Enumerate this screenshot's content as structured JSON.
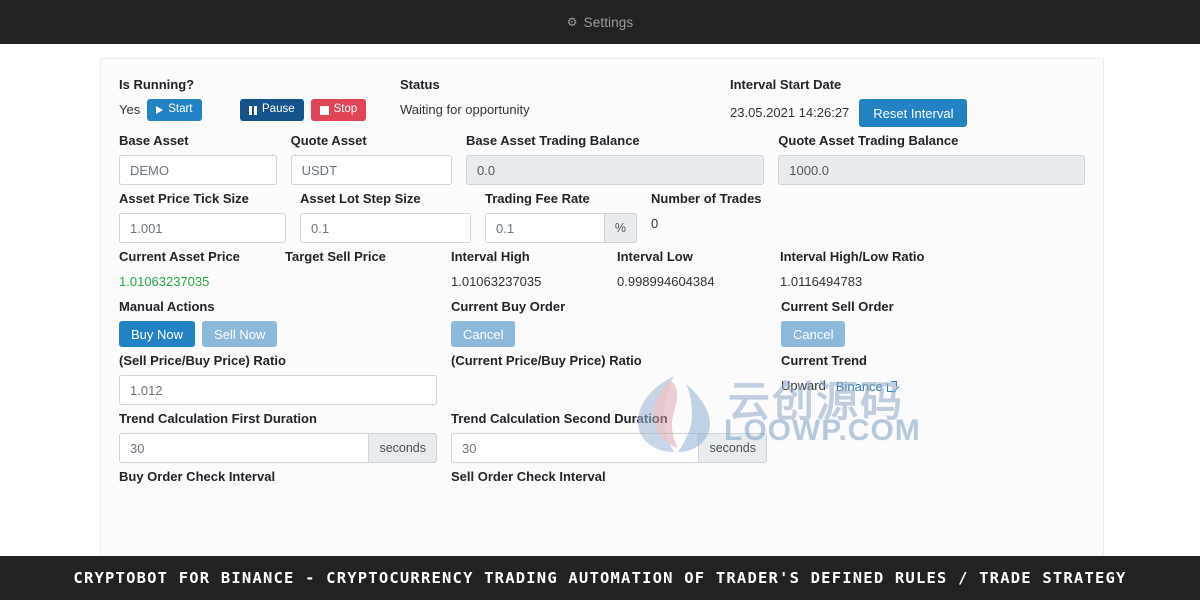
{
  "navbar": {
    "settings_label": "Settings",
    "gear_icon": "gear-icon"
  },
  "fields": {
    "is_running": {
      "label": "Is Running?",
      "value": "Yes"
    },
    "status": {
      "label": "Status",
      "value": "Waiting for opportunity"
    },
    "interval_start": {
      "label": "Interval Start Date",
      "value": "23.05.2021 14:26:27",
      "button": "Reset Interval"
    },
    "base_asset": {
      "label": "Base Asset",
      "value": "DEMO"
    },
    "quote_asset": {
      "label": "Quote Asset",
      "value": "USDT"
    },
    "base_balance": {
      "label": "Base Asset Trading Balance",
      "value": "0.0"
    },
    "quote_balance": {
      "label": "Quote Asset Trading Balance",
      "value": "1000.0"
    },
    "tick_size": {
      "label": "Asset Price Tick Size",
      "value": "1.001"
    },
    "lot_step": {
      "label": "Asset Lot Step Size",
      "value": "0.1"
    },
    "fee_rate": {
      "label": "Trading Fee Rate",
      "value": "0.1",
      "addon": "%"
    },
    "num_trades": {
      "label": "Number of Trades",
      "value": "0"
    },
    "current_price": {
      "label": "Current Asset Price",
      "value": "1.01063237035"
    },
    "target_sell": {
      "label": "Target Sell Price",
      "value": ""
    },
    "interval_high": {
      "label": "Interval High",
      "value": "1.01063237035"
    },
    "interval_low": {
      "label": "Interval Low",
      "value": "0.998994604384"
    },
    "interval_ratio": {
      "label": "Interval High/Low Ratio",
      "value": "1.0116494783"
    },
    "manual_actions": {
      "label": "Manual Actions",
      "buy": "Buy Now",
      "sell": "Sell Now"
    },
    "current_buy_order": {
      "label": "Current Buy Order",
      "cancel": "Cancel"
    },
    "current_sell_order": {
      "label": "Current Sell Order",
      "cancel": "Cancel"
    },
    "sell_buy_ratio": {
      "label": "(Sell Price/Buy Price) Ratio",
      "value": "1.012"
    },
    "current_buy_ratio": {
      "label": "(Current Price/Buy Price) Ratio"
    },
    "current_trend": {
      "label": "Current Trend",
      "value": "Upward",
      "link": "Binance",
      "link_icon": "external-link-icon"
    },
    "trend_first": {
      "label": "Trend Calculation First Duration",
      "value": "30",
      "addon": "seconds"
    },
    "trend_second": {
      "label": "Trend Calculation Second Duration",
      "value": "30",
      "addon": "seconds"
    },
    "buy_check": {
      "label": "Buy Order Check Interval"
    },
    "sell_check": {
      "label": "Sell Order Check Interval"
    }
  },
  "controls": {
    "start": {
      "label": "Start",
      "icon": "play-icon"
    },
    "pause": {
      "label": "Pause",
      "icon": "pause-icon"
    },
    "stop": {
      "label": "Stop",
      "icon": "stop-icon"
    }
  },
  "watermark": {
    "cn": "云创源码",
    "en_primary": "LOOWP",
    "en_suffix": ".COM",
    "logo_icon": "lotus-logo-icon"
  },
  "footer": {
    "text": "CRYPTOBOT FOR BINANCE - CRYPTOCURRENCY TRADING AUTOMATION OF TRADER'S DEFINED RULES / TRADE STRATEGY"
  },
  "colors": {
    "primary": "#2382c4",
    "danger": "#e04555",
    "dark_btn": "#14538c",
    "price_green": "#28a745",
    "link": "#337ab7"
  }
}
